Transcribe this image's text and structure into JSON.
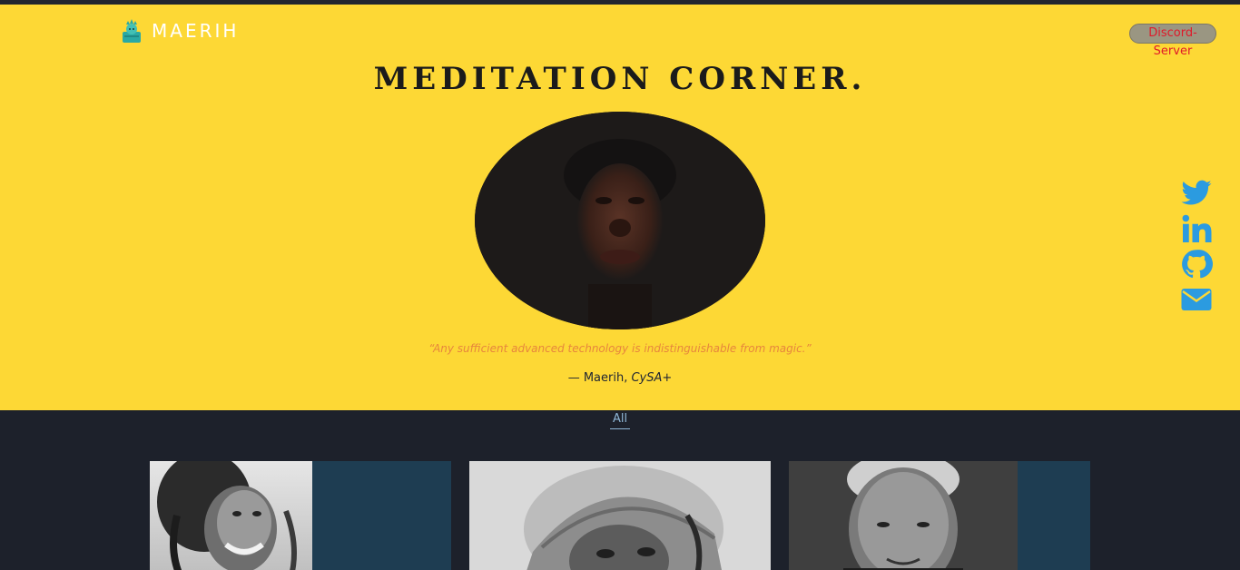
{
  "brand": {
    "name": "MAERIH",
    "logo_icon": "statue-of-liberty-icon"
  },
  "header": {
    "discord_label": "Discord-Server"
  },
  "hero": {
    "title": "MEDITATION CORNER.",
    "quote": "“Any sufficient advanced technology is indistinguishable from magic.”",
    "attribution_prefix": "— Maerih, ",
    "attribution_cert": "CySA+"
  },
  "social": [
    {
      "name": "twitter-icon"
    },
    {
      "name": "linkedin-icon"
    },
    {
      "name": "github-icon"
    },
    {
      "name": "envelope-icon"
    }
  ],
  "filters": {
    "all_label": "All"
  },
  "colors": {
    "hero_bg": "#fdd835",
    "page_bg": "#1d212b",
    "social_blue": "#2b9be0",
    "discord_text": "#e0192a",
    "quote_orange": "#e7863d",
    "card_bg": "#1e3d52",
    "filter_blue": "#8fb7d6"
  }
}
